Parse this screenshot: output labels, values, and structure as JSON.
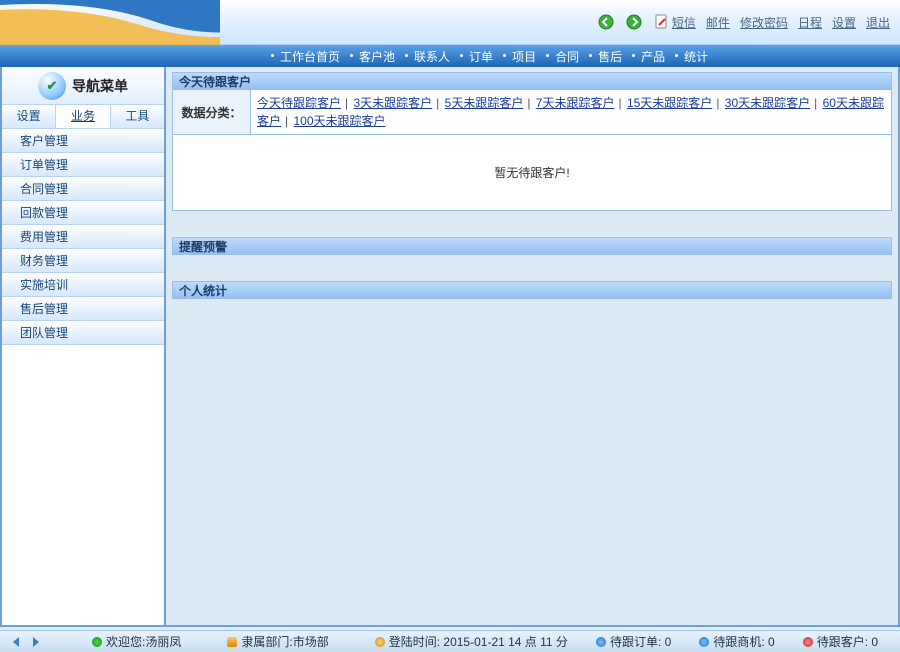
{
  "header": {
    "icons": [
      "back-icon",
      "forward-icon",
      "stop-icon"
    ],
    "links": [
      "短信",
      "邮件",
      "修改密码",
      "日程",
      "设置",
      "退出"
    ]
  },
  "menu": [
    "工作台首页",
    "客户池",
    "联系人",
    "订单",
    "项目",
    "合同",
    "售后",
    "产品",
    "统计"
  ],
  "sidebar": {
    "title": "导航菜单",
    "tabs": [
      "设置",
      "业务",
      "工具"
    ],
    "active_tab": 1,
    "items": [
      "客户管理",
      "订单管理",
      "合同管理",
      "回款管理",
      "费用管理",
      "财务管理",
      "实施培训",
      "售后管理",
      "团队管理"
    ]
  },
  "sections": {
    "today_follow": "今天待跟客户",
    "filter_label": "数据分类：",
    "filters": [
      "今天待跟踪客户",
      "3天未跟踪客户",
      "5天未跟踪客户",
      "7天未跟踪客户",
      "15天未跟踪客户",
      "30天未跟踪客户",
      "60天未跟踪客户",
      "100天未跟踪客户"
    ],
    "empty_text": "暂无待跟客户!",
    "reminder": "提醒预警",
    "personal_stats": "个人统计"
  },
  "status": {
    "welcome_label": "欢迎您:",
    "welcome_user": "汤丽凤",
    "dept_label": "隶属部门:",
    "dept": "市场部",
    "login_label": "登陆时间:",
    "login_time": "2015-01-21 14 点 11 分",
    "pending_orders_label": "待跟订单:",
    "pending_orders": "0",
    "pending_opps_label": "待跟商机:",
    "pending_opps": "0",
    "pending_cust_label": "待跟客户:",
    "pending_cust": "0"
  }
}
